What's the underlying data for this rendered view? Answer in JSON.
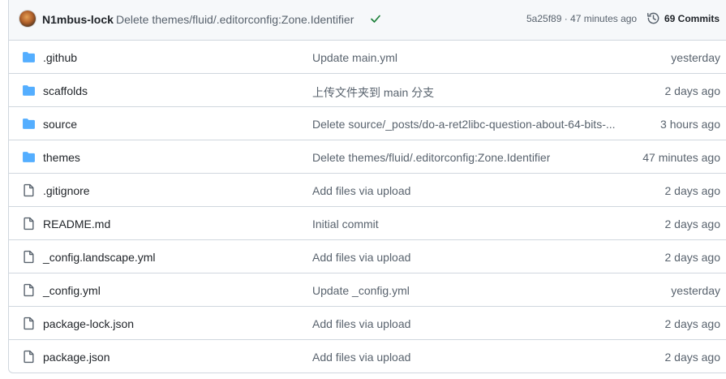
{
  "latest_commit": {
    "author": "N1mbus-lock",
    "message": "Delete themes/fluid/.editorconfig:Zone.Identifier",
    "meta": "5a25f89 · 47 minutes ago",
    "commits_label": "69 Commits",
    "status_color": "#1a7f37"
  },
  "colors": {
    "folder": "#54aeff",
    "file_icon": "#59636e",
    "border": "#d0d7de"
  },
  "files": [
    {
      "type": "folder",
      "icon": "folder-icon",
      "name": ".github",
      "message": "Update main.yml",
      "age": "yesterday"
    },
    {
      "type": "folder",
      "icon": "folder-icon",
      "name": "scaffolds",
      "message": "上传文件夹到 main 分支",
      "age": "2 days ago"
    },
    {
      "type": "folder",
      "icon": "folder-icon",
      "name": "source",
      "message": "Delete source/_posts/do-a-ret2libc-question-about-64-bits-...",
      "age": "3 hours ago"
    },
    {
      "type": "folder",
      "icon": "folder-icon",
      "name": "themes",
      "message": "Delete themes/fluid/.editorconfig:Zone.Identifier",
      "age": "47 minutes ago"
    },
    {
      "type": "file",
      "icon": "file-icon",
      "name": ".gitignore",
      "message": "Add files via upload",
      "age": "2 days ago"
    },
    {
      "type": "file",
      "icon": "file-icon",
      "name": "README.md",
      "message": "Initial commit",
      "age": "2 days ago"
    },
    {
      "type": "file",
      "icon": "file-icon",
      "name": "_config.landscape.yml",
      "message": "Add files via upload",
      "age": "2 days ago"
    },
    {
      "type": "file",
      "icon": "file-icon",
      "name": "_config.yml",
      "message": "Update _config.yml",
      "age": "yesterday"
    },
    {
      "type": "file",
      "icon": "file-icon",
      "name": "package-lock.json",
      "message": "Add files via upload",
      "age": "2 days ago"
    },
    {
      "type": "file",
      "icon": "file-icon",
      "name": "package.json",
      "message": "Add files via upload",
      "age": "2 days ago"
    }
  ]
}
